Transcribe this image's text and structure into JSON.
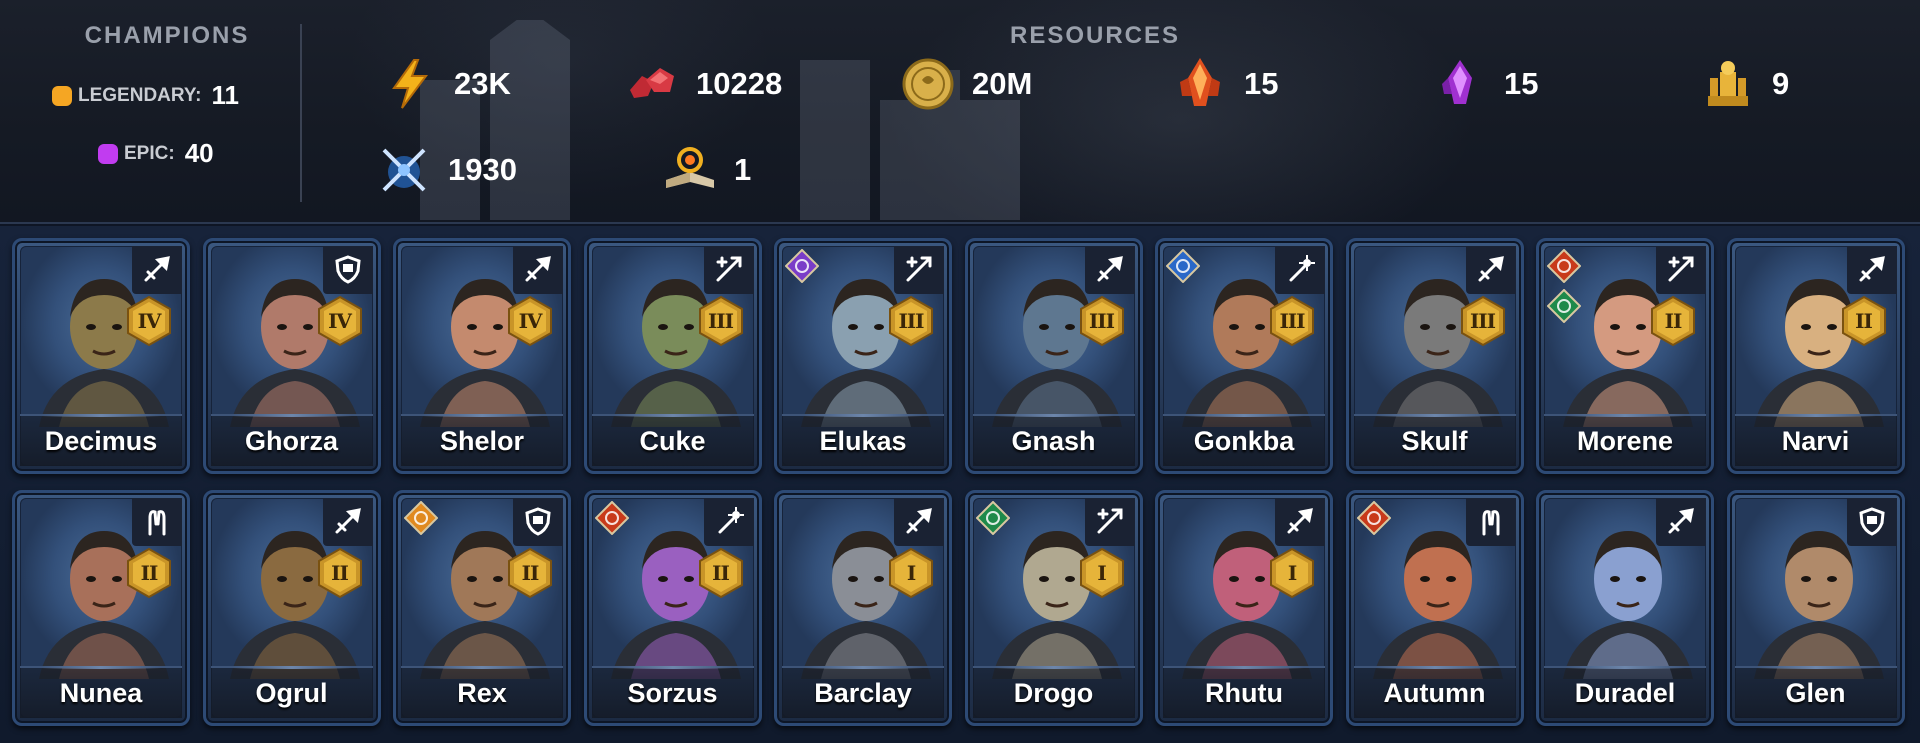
{
  "champions": {
    "title": "CHAMPIONS",
    "legendary": {
      "label": "LEGENDARY:",
      "count": "11",
      "color": "#f5a623"
    },
    "epic": {
      "label": "EPIC:",
      "count": "40",
      "color": "#c13cf0"
    }
  },
  "resources": {
    "title": "RESOURCES",
    "items": [
      {
        "icon": "energy-bolt-icon",
        "value": "23K"
      },
      {
        "icon": "rubies-icon",
        "value": "10228"
      },
      {
        "icon": "silver-coin-icon",
        "value": "20M"
      },
      {
        "icon": "legendary-shard-icon",
        "value": "15"
      },
      {
        "icon": "epic-shard-icon",
        "value": "15"
      },
      {
        "icon": "gold-statue-icon",
        "value": "9"
      },
      {
        "icon": "arena-swords-icon",
        "value": "1930"
      },
      {
        "icon": "tome-icon",
        "value": "1"
      }
    ]
  },
  "cards": [
    {
      "name": "Decimus",
      "rank": "IV",
      "type": "attack",
      "rarity": "legendary",
      "affinity": [],
      "skin": "#8c7a4a"
    },
    {
      "name": "Ghorza",
      "rank": "IV",
      "type": "defense",
      "rarity": "legendary",
      "affinity": [],
      "skin": "#b07a6a"
    },
    {
      "name": "Shelor",
      "rank": "IV",
      "type": "attack",
      "rarity": "legendary",
      "affinity": [],
      "skin": "#c48a6e"
    },
    {
      "name": "Cuke",
      "rank": "III",
      "type": "support",
      "rarity": "epic",
      "affinity": [],
      "skin": "#7a8c5a"
    },
    {
      "name": "Elukas",
      "rank": "III",
      "type": "support",
      "rarity": "epic",
      "affinity": [
        "void"
      ],
      "skin": "#8aa0b0"
    },
    {
      "name": "Gnash",
      "rank": "III",
      "type": "attack",
      "rarity": "epic",
      "affinity": [],
      "skin": "#5e7790"
    },
    {
      "name": "Gonkba",
      "rank": "III",
      "type": "magic",
      "rarity": "epic",
      "affinity": [
        "magic"
      ],
      "skin": "#b07a5a"
    },
    {
      "name": "Skulf",
      "rank": "III",
      "type": "attack",
      "rarity": "epic",
      "affinity": [],
      "skin": "#7a7a7a"
    },
    {
      "name": "Morene",
      "rank": "II",
      "type": "support",
      "rarity": "epic",
      "affinity": [
        "force",
        "spirit"
      ],
      "skin": "#d49a80"
    },
    {
      "name": "Narvi",
      "rank": "II",
      "type": "attack",
      "rarity": "epic",
      "affinity": [],
      "skin": "#d8b080"
    },
    {
      "name": "Nunea",
      "rank": "II",
      "type": "heal",
      "rarity": "epic",
      "affinity": [],
      "skin": "#a8705a"
    },
    {
      "name": "Ogrul",
      "rank": "II",
      "type": "attack",
      "rarity": "epic",
      "affinity": [],
      "skin": "#8a6a40"
    },
    {
      "name": "Rex",
      "rank": "II",
      "type": "defense",
      "rarity": "epic",
      "affinity": [
        "gold"
      ],
      "skin": "#a07858"
    },
    {
      "name": "Sorzus",
      "rank": "II",
      "type": "magic",
      "rarity": "epic",
      "affinity": [
        "force"
      ],
      "skin": "#9a60c0"
    },
    {
      "name": "Barclay",
      "rank": "I",
      "type": "attack",
      "rarity": "epic",
      "affinity": [],
      "skin": "#8a8e96"
    },
    {
      "name": "Drogo",
      "rank": "I",
      "type": "support",
      "rarity": "epic",
      "affinity": [
        "spirit"
      ],
      "skin": "#b0a890"
    },
    {
      "name": "Rhutu",
      "rank": "I",
      "type": "attack",
      "rarity": "epic",
      "affinity": [],
      "skin": "#c0607a"
    },
    {
      "name": "Autumn",
      "rank": "",
      "type": "heal",
      "rarity": "epic",
      "affinity": [
        "force"
      ],
      "skin": "#c07050"
    },
    {
      "name": "Duradel",
      "rank": "",
      "type": "attack",
      "rarity": "epic",
      "affinity": [],
      "skin": "#8aa0d0"
    },
    {
      "name": "Glen",
      "rank": "",
      "type": "defense",
      "rarity": "epic",
      "affinity": [],
      "skin": "#b08a6a"
    }
  ],
  "colors": {
    "affinity_void": "#7a3cc8",
    "affinity_magic": "#2a68c8",
    "affinity_force": "#c83a1a",
    "affinity_spirit": "#1e8a4a",
    "affinity_gold": "#e08a20",
    "rank_gold": "#e6b43a"
  }
}
